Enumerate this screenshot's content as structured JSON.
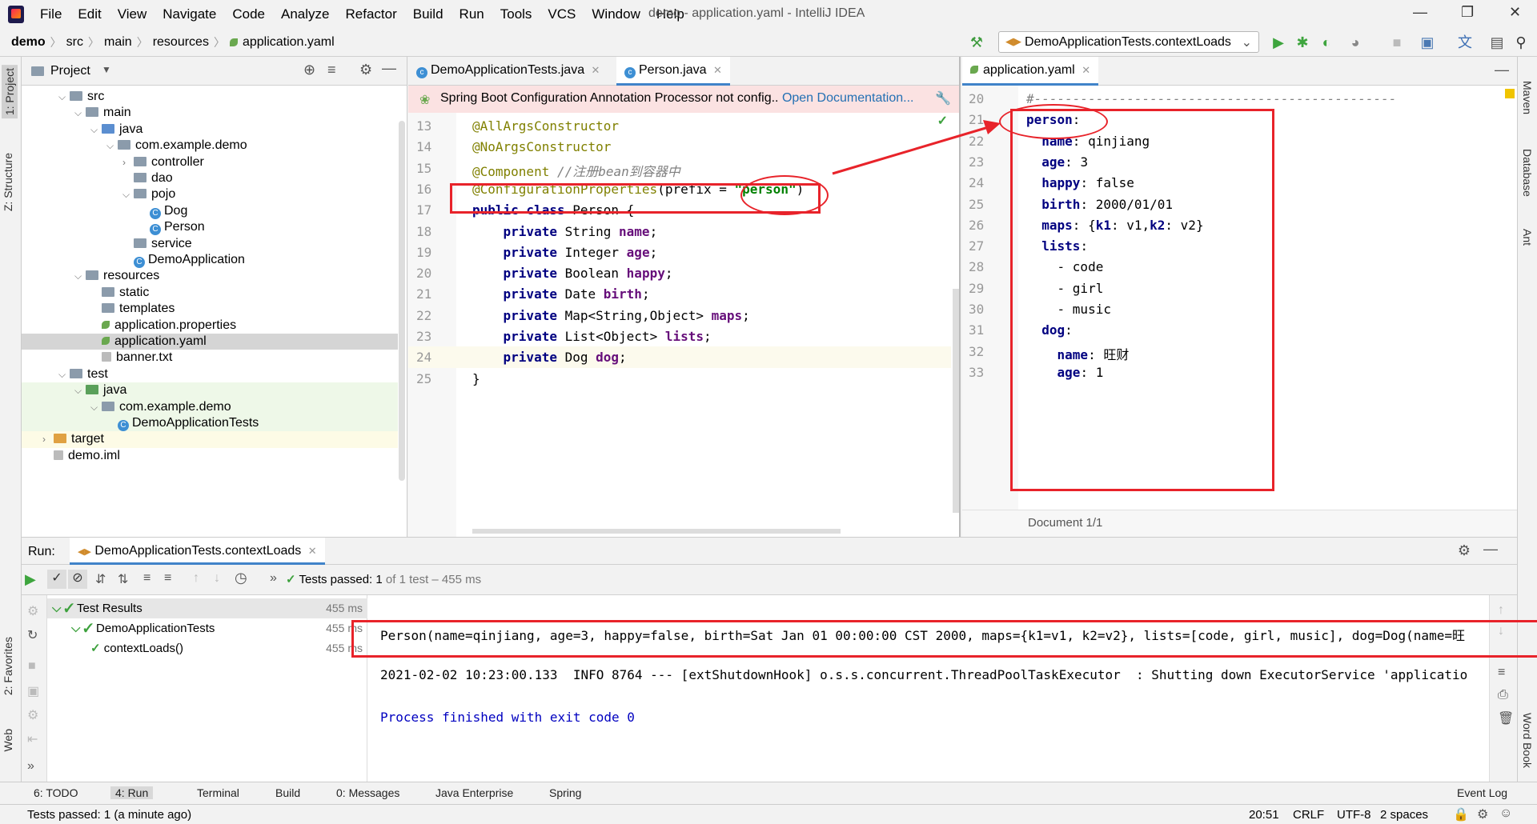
{
  "menubar": {
    "items": [
      "File",
      "Edit",
      "View",
      "Navigate",
      "Code",
      "Analyze",
      "Refactor",
      "Build",
      "Run",
      "Tools",
      "VCS",
      "Window",
      "Help"
    ],
    "title": "demo - application.yaml - IntelliJ IDEA"
  },
  "navbar": {
    "breadcrumbs": [
      "demo",
      "src",
      "main",
      "resources",
      "application.yaml"
    ],
    "run_config": "DemoApplicationTests.contextLoads"
  },
  "left_tabs": [
    "1: Project",
    "Z: Structure",
    "2: Favorites",
    "Web"
  ],
  "right_tabs": [
    "Maven",
    "Database",
    "Ant",
    "Word Book"
  ],
  "project": {
    "header": "Project",
    "tree": [
      {
        "label": "src",
        "indent": 1,
        "icon": "folder",
        "arrow": "down"
      },
      {
        "label": "main",
        "indent": 2,
        "icon": "folder",
        "arrow": "down"
      },
      {
        "label": "java",
        "indent": 3,
        "icon": "folder-blue",
        "arrow": "down"
      },
      {
        "label": "com.example.demo",
        "indent": 4,
        "icon": "package",
        "arrow": "down"
      },
      {
        "label": "controller",
        "indent": 5,
        "icon": "package",
        "arrow": "right"
      },
      {
        "label": "dao",
        "indent": 5,
        "icon": "package",
        "arrow": ""
      },
      {
        "label": "pojo",
        "indent": 5,
        "icon": "package",
        "arrow": "down"
      },
      {
        "label": "Dog",
        "indent": 6,
        "icon": "class",
        "arrow": ""
      },
      {
        "label": "Person",
        "indent": 6,
        "icon": "class",
        "arrow": ""
      },
      {
        "label": "service",
        "indent": 5,
        "icon": "package",
        "arrow": ""
      },
      {
        "label": "DemoApplication",
        "indent": 5,
        "icon": "spring-class",
        "arrow": ""
      },
      {
        "label": "resources",
        "indent": 2,
        "icon": "folder-res",
        "arrow": "down"
      },
      {
        "label": "static",
        "indent": 3,
        "icon": "folder",
        "arrow": ""
      },
      {
        "label": "templates",
        "indent": 3,
        "icon": "folder",
        "arrow": ""
      },
      {
        "label": "application.properties",
        "indent": 3,
        "icon": "spring-file",
        "arrow": ""
      },
      {
        "label": "application.yaml",
        "indent": 3,
        "icon": "spring-file",
        "arrow": "",
        "selected": true
      },
      {
        "label": "banner.txt",
        "indent": 3,
        "icon": "text-file",
        "arrow": ""
      },
      {
        "label": "test",
        "indent": 1,
        "icon": "folder",
        "arrow": "down"
      },
      {
        "label": "java",
        "indent": 2,
        "icon": "folder-green",
        "arrow": "down",
        "highlight": true
      },
      {
        "label": "com.example.demo",
        "indent": 3,
        "icon": "package",
        "arrow": "down",
        "highlight": true
      },
      {
        "label": "DemoApplicationTests",
        "indent": 4,
        "icon": "spring-class",
        "arrow": "",
        "highlight": true
      },
      {
        "label": "target",
        "indent": 0,
        "icon": "folder-orange",
        "arrow": "right",
        "highlight2": true
      },
      {
        "label": "demo.iml",
        "indent": 0,
        "icon": "file",
        "arrow": ""
      }
    ]
  },
  "editor1": {
    "tabs": [
      "DemoApplicationTests.java",
      "Person.java"
    ],
    "banner": "Spring Boot Configuration Annotation Processor not config..",
    "banner_link": "Open Documentation...",
    "lines": [
      {
        "n": "13",
        "html": "<span class='ann'>@AllArgsConstructor</span>"
      },
      {
        "n": "14",
        "html": "<span class='ann'>@NoArgsConstructor</span>"
      },
      {
        "n": "15",
        "html": "<span class='ann'>@Component</span> <span class='cmt'>//注册bean到容器中</span>"
      },
      {
        "n": "16",
        "html": "<span class='ann'>@ConfigurationProperties</span>(prefix = <span class='str'>\"person\"</span>)"
      },
      {
        "n": "17",
        "html": "<span class='kw'>public class</span> Person {"
      },
      {
        "n": "18",
        "html": "    <span class='kw'>private</span> String <span class='fld'>name</span>;"
      },
      {
        "n": "19",
        "html": "    <span class='kw'>private</span> Integer <span class='fld'>age</span>;"
      },
      {
        "n": "20",
        "html": "    <span class='kw'>private</span> Boolean <span class='fld'>happy</span>;"
      },
      {
        "n": "21",
        "html": "    <span class='kw'>private</span> Date <span class='fld'>birth</span>;"
      },
      {
        "n": "22",
        "html": "    <span class='kw'>private</span> Map&lt;String,Object&gt; <span class='fld'>maps</span>;"
      },
      {
        "n": "23",
        "html": "    <span class='kw'>private</span> List&lt;Object&gt; <span class='fld'>lists</span>;"
      },
      {
        "n": "24",
        "html": "    <span class='kw'>private</span> Dog <span class='fld'>dog</span>;"
      },
      {
        "n": "25",
        "html": "}"
      }
    ]
  },
  "editor2": {
    "tab": "application.yaml",
    "footer": "Document 1/1",
    "lines": [
      {
        "n": "20",
        "html": "<span class='cmt'>#-----------------------------------------------</span>"
      },
      {
        "n": "21",
        "html": "<span class='yk'>person</span>:"
      },
      {
        "n": "22",
        "html": "  <span class='yk'>name</span>: qinjiang"
      },
      {
        "n": "23",
        "html": "  <span class='yk'>age</span>: 3"
      },
      {
        "n": "24",
        "html": "  <span class='yk'>happy</span>: false"
      },
      {
        "n": "25",
        "html": "  <span class='yk'>birth</span>: 2000/01/01"
      },
      {
        "n": "26",
        "html": "  <span class='yk'>maps</span>: {<span class='yk'>k1</span>: v1,<span class='yk'>k2</span>: v2}"
      },
      {
        "n": "27",
        "html": "  <span class='yk'>lists</span>:"
      },
      {
        "n": "28",
        "html": "    - code"
      },
      {
        "n": "29",
        "html": "    - girl"
      },
      {
        "n": "30",
        "html": "    - music"
      },
      {
        "n": "31",
        "html": "  <span class='yk'>dog</span>:"
      },
      {
        "n": "32",
        "html": "    <span class='yk'>name</span>: 旺财"
      },
      {
        "n": "33",
        "html": "    <span class='yk'>age</span>: 1"
      }
    ]
  },
  "run": {
    "label": "Run:",
    "tab": "DemoApplicationTests.contextLoads",
    "status_prefix": "Tests passed:",
    "status_count": "1",
    "status_rest": "of 1 test – 455 ms",
    "results": [
      {
        "label": "Test Results",
        "time": "455 ms",
        "indent": 0
      },
      {
        "label": "DemoApplicationTests",
        "time": "455 ms",
        "indent": 1
      },
      {
        "label": "contextLoads()",
        "time": "455 ms",
        "indent": 2
      }
    ],
    "console": [
      "Person(name=qinjiang, age=3, happy=false, birth=Sat Jan 01 00:00:00 CST 2000, maps={k1=v1, k2=v2}, lists=[code, girl, music], dog=Dog(name=旺",
      "2021-02-02 10:23:00.133  INFO 8764 --- [extShutdownHook] o.s.s.concurrent.ThreadPoolTaskExecutor  : Shutting down ExecutorService 'applicatio",
      "Process finished with exit code 0"
    ]
  },
  "bottom_tabs": [
    "6: TODO",
    "4: Run",
    "Terminal",
    "Build",
    "0: Messages",
    "Java Enterprise",
    "Spring"
  ],
  "event_log": "Event Log",
  "status": {
    "message": "Tests passed: 1 (a minute ago)",
    "position": "20:51",
    "line_sep": "CRLF",
    "encoding": "UTF-8",
    "indent": "2 spaces"
  }
}
